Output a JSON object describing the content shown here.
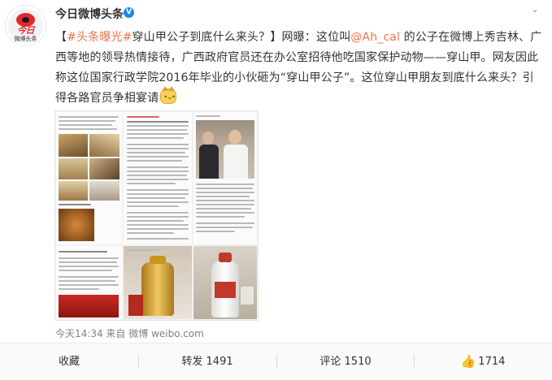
{
  "author": {
    "name": "今日微博头条",
    "verified_mark": "V",
    "avatar_logo": "今日",
    "avatar_sub": "微博头条"
  },
  "menu": {
    "more_glyph": "⌄"
  },
  "post": {
    "hashtag": "#头条曝光#",
    "seg1": "穿山甲公子到底什么来头？】网曝：这位叫",
    "open_bracket": "【",
    "mention": "@Ah_cal",
    "seg2": " 的公子在微博上秀吉林、广西等地的领导热情接待，广西政府官员还在办公室招待他吃国家保护动物——穿山甲。网友因此称这位国家行政学院2016年毕业的小伙砸为“穿山甲公子”。这位穿山甲朋友到底什么来头？引得各路官员争相宴请"
  },
  "timestamp": {
    "time": "今天14:34",
    "source_prefix": "来自",
    "source": "微博 weibo.com"
  },
  "actions": {
    "collect": "收藏",
    "repost": "转发 1491",
    "comment": "评论 1510",
    "like_count": "1714"
  },
  "colors": {
    "link": "#eb7350",
    "brand_red": "#e5262e",
    "verify_blue": "#1b8be8"
  }
}
